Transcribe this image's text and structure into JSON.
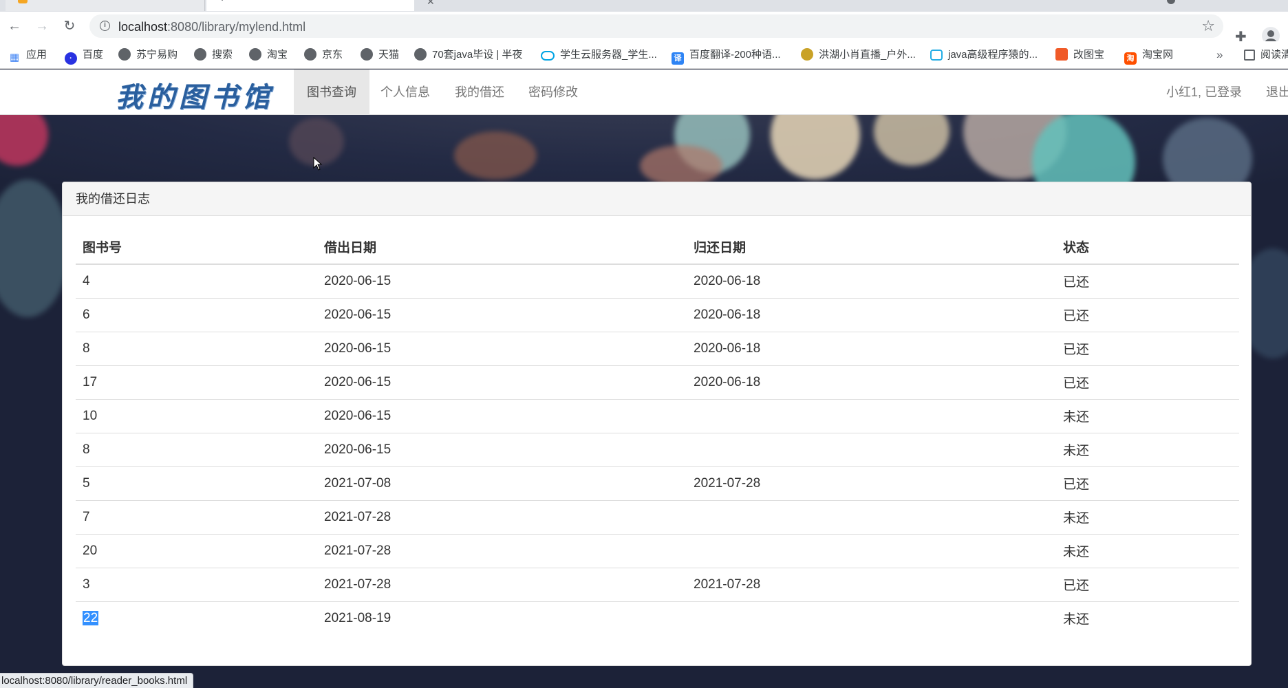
{
  "browser": {
    "url_host": "localhost",
    "url_path": ":8080/library/mylend.html",
    "status_url": "localhost:8080/library/reader_books.html",
    "bookmarks": [
      {
        "label": "应用",
        "icon": "apps-grid-icon"
      },
      {
        "label": "百度",
        "icon": "baidu-paw-icon"
      },
      {
        "label": "苏宁易购",
        "icon": "globe-icon"
      },
      {
        "label": "搜索",
        "icon": "globe-icon"
      },
      {
        "label": "淘宝",
        "icon": "globe-icon"
      },
      {
        "label": "京东",
        "icon": "globe-icon"
      },
      {
        "label": "天猫",
        "icon": "globe-icon"
      },
      {
        "label": "70套java毕设 | 半夜",
        "icon": "globe-icon"
      },
      {
        "label": "学生云服务器_学生...",
        "icon": "cloud-icon"
      },
      {
        "label": "百度翻译-200种语...",
        "icon": "translate-icon"
      },
      {
        "label": "洪湖小肖直播_户外...",
        "icon": "eagle-icon"
      },
      {
        "label": "java高级程序猿的...",
        "icon": "bilibili-icon"
      },
      {
        "label": "改图宝",
        "icon": "gaitubao-icon"
      },
      {
        "label": "淘宝网",
        "icon": "taobao-icon"
      }
    ],
    "bookmarks_overflow": "»",
    "reading_list_label": "阅读清"
  },
  "site": {
    "brand": "我的图书馆",
    "nav": [
      "图书查询",
      "个人信息",
      "我的借还",
      "密码修改"
    ],
    "user_status": "小红1, 已登录",
    "logout": "退出"
  },
  "panel": {
    "title": "我的借还日志",
    "columns": [
      "图书号",
      "借出日期",
      "归还日期",
      "状态"
    ],
    "rows": [
      {
        "book_id": "4",
        "lend_date": "2020-06-15",
        "return_date": "2020-06-18",
        "status": "已还"
      },
      {
        "book_id": "6",
        "lend_date": "2020-06-15",
        "return_date": "2020-06-18",
        "status": "已还"
      },
      {
        "book_id": "8",
        "lend_date": "2020-06-15",
        "return_date": "2020-06-18",
        "status": "已还"
      },
      {
        "book_id": "17",
        "lend_date": "2020-06-15",
        "return_date": "2020-06-18",
        "status": "已还"
      },
      {
        "book_id": "10",
        "lend_date": "2020-06-15",
        "return_date": "",
        "status": "未还"
      },
      {
        "book_id": "8",
        "lend_date": "2020-06-15",
        "return_date": "",
        "status": "未还"
      },
      {
        "book_id": "5",
        "lend_date": "2021-07-08",
        "return_date": "2021-07-28",
        "status": "已还"
      },
      {
        "book_id": "7",
        "lend_date": "2021-07-28",
        "return_date": "",
        "status": "未还"
      },
      {
        "book_id": "20",
        "lend_date": "2021-07-28",
        "return_date": "",
        "status": "未还"
      },
      {
        "book_id": "3",
        "lend_date": "2021-07-28",
        "return_date": "2021-07-28",
        "status": "已还"
      },
      {
        "book_id": "22",
        "lend_date": "2021-08-19",
        "return_date": "",
        "status": "未还"
      }
    ]
  },
  "colors": {
    "brand": "#2a5f9e",
    "nav_active_bg": "#e7e7e7",
    "selection": "#3390ff"
  }
}
